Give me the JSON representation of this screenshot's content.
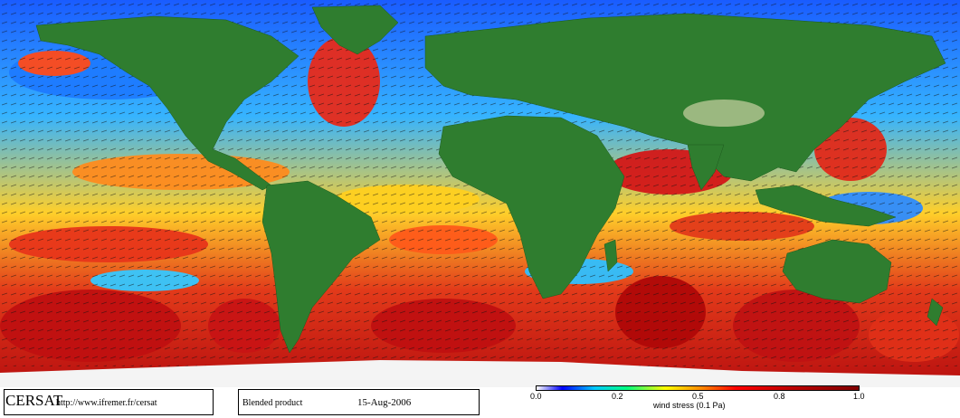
{
  "map": {
    "product_title": "Blended product",
    "date": "15-Aug-2006",
    "logo": "CERSAT",
    "url": "http://www.ifremer.fr/cersat",
    "colorbar": {
      "ticks": [
        "0.0",
        "0.2",
        "0.5",
        "0.8",
        "1.0"
      ],
      "label": "wind stress (0.1 Pa)",
      "colors": [
        "#ffffff",
        "#0000ff",
        "#00c8ff",
        "#00ff80",
        "#ffff00",
        "#ff8000",
        "#ff0000",
        "#800000"
      ]
    },
    "land_color": "#2f7d2f",
    "ice_color": "#f4f4f4"
  }
}
